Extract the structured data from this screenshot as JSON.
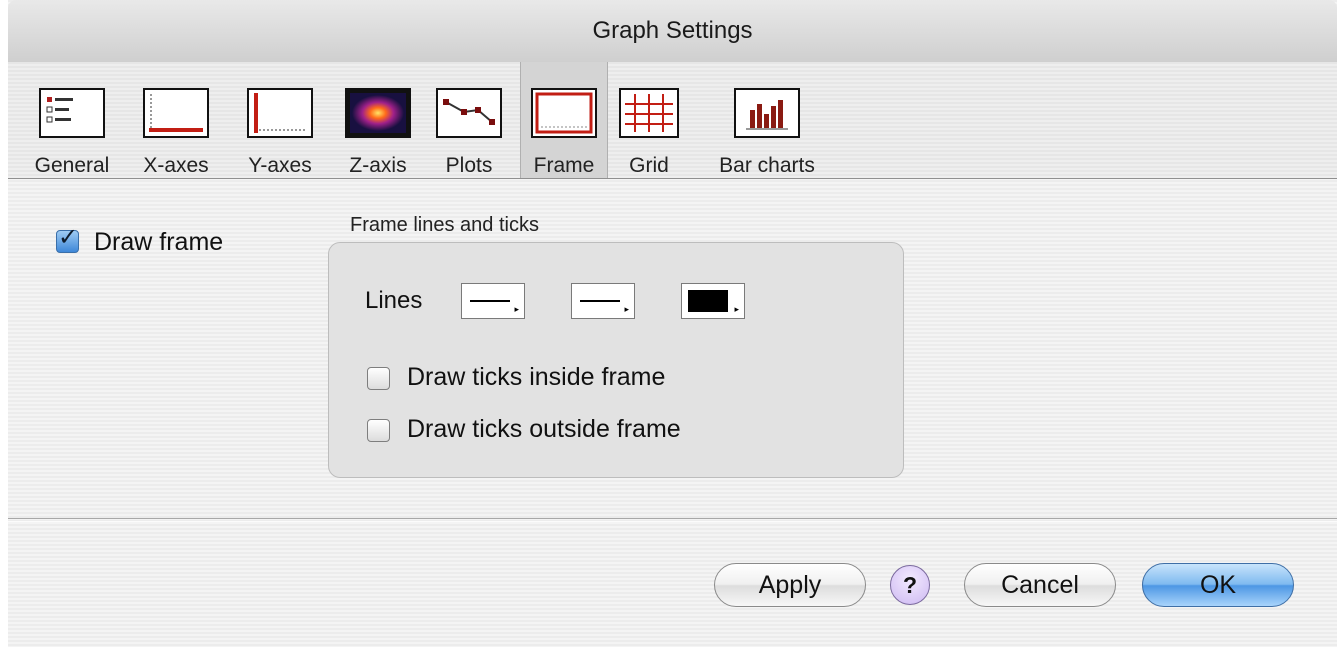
{
  "window": {
    "title": "Graph Settings"
  },
  "tabs": [
    {
      "label": "General",
      "icon": "general-settings-icon"
    },
    {
      "label": "X-axes",
      "icon": "x-axis-icon"
    },
    {
      "label": "Y-axes",
      "icon": "y-axis-icon"
    },
    {
      "label": "Z-axis",
      "icon": "z-axis-heatmap-icon"
    },
    {
      "label": "Plots",
      "icon": "plot-line-icon"
    },
    {
      "label": "Frame",
      "icon": "frame-icon",
      "selected": true
    },
    {
      "label": "Grid",
      "icon": "grid-icon"
    },
    {
      "label": "Bar charts",
      "icon": "bar-chart-icon"
    }
  ],
  "frame": {
    "draw_frame_label": "Draw frame",
    "draw_frame_checked": true,
    "group_title": "Frame lines and ticks",
    "lines_label": "Lines",
    "line_color": "#000000",
    "ticks_inside_label": "Draw ticks inside frame",
    "ticks_inside_checked": false,
    "ticks_outside_label": "Draw ticks outside frame",
    "ticks_outside_checked": false
  },
  "buttons": {
    "apply": "Apply",
    "help": "?",
    "cancel": "Cancel",
    "ok": "OK"
  }
}
